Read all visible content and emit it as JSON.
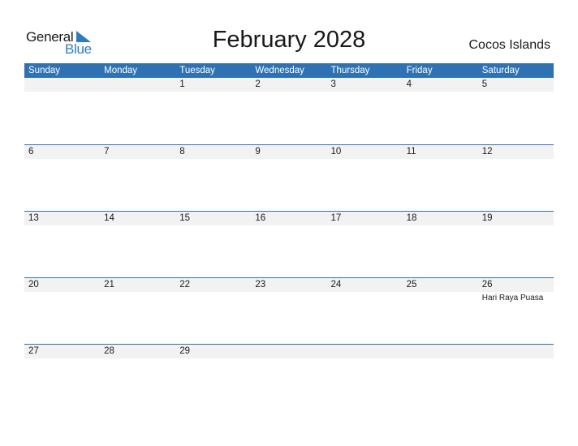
{
  "logo": {
    "general": "General",
    "blue": "Blue",
    "accent_color": "#2d7cc1"
  },
  "title": "February 2028",
  "country": "Cocos Islands",
  "header_color": "#2e72b3",
  "weekdays": [
    "Sunday",
    "Monday",
    "Tuesday",
    "Wednesday",
    "Thursday",
    "Friday",
    "Saturday"
  ],
  "weeks": [
    {
      "days": [
        "",
        "",
        "1",
        "2",
        "3",
        "4",
        "5"
      ],
      "events": [
        "",
        "",
        "",
        "",
        "",
        "",
        ""
      ]
    },
    {
      "days": [
        "6",
        "7",
        "8",
        "9",
        "10",
        "11",
        "12"
      ],
      "events": [
        "",
        "",
        "",
        "",
        "",
        "",
        ""
      ]
    },
    {
      "days": [
        "13",
        "14",
        "15",
        "16",
        "17",
        "18",
        "19"
      ],
      "events": [
        "",
        "",
        "",
        "",
        "",
        "",
        ""
      ]
    },
    {
      "days": [
        "20",
        "21",
        "22",
        "23",
        "24",
        "25",
        "26"
      ],
      "events": [
        "",
        "",
        "",
        "",
        "",
        "",
        "Hari Raya Puasa"
      ]
    },
    {
      "days": [
        "27",
        "28",
        "29",
        "",
        "",
        "",
        ""
      ],
      "events": [
        "",
        "",
        "",
        "",
        "",
        "",
        ""
      ]
    }
  ]
}
